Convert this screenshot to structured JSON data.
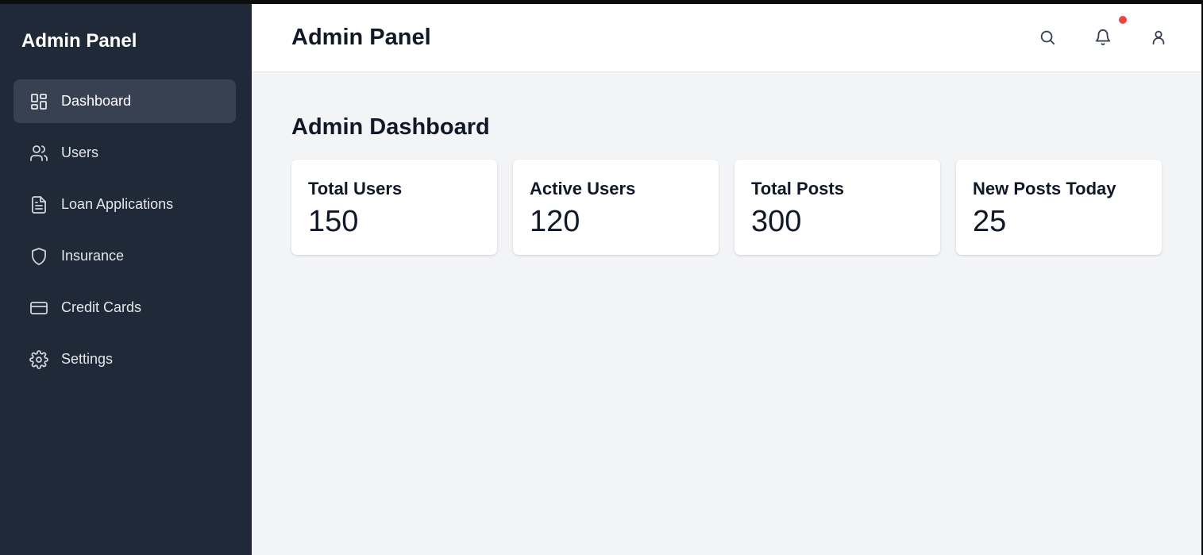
{
  "sidebar": {
    "brand": "Admin Panel",
    "items": [
      {
        "label": "Dashboard",
        "icon": "dashboard-icon",
        "active": true
      },
      {
        "label": "Users",
        "icon": "users-icon"
      },
      {
        "label": "Loan Applications",
        "icon": "document-icon"
      },
      {
        "label": "Insurance",
        "icon": "shield-icon"
      },
      {
        "label": "Credit Cards",
        "icon": "credit-card-icon"
      },
      {
        "label": "Settings",
        "icon": "gear-icon"
      }
    ]
  },
  "header": {
    "title": "Admin Panel",
    "icons": [
      "search-icon",
      "bell-icon",
      "user-icon"
    ],
    "has_notification": true
  },
  "main": {
    "title": "Admin Dashboard",
    "stats": [
      {
        "label": "Total Users",
        "value": "150"
      },
      {
        "label": "Active Users",
        "value": "120"
      },
      {
        "label": "Total Posts",
        "value": "300"
      },
      {
        "label": "New Posts Today",
        "value": "25"
      }
    ]
  },
  "colors": {
    "sidebar_bg": "#1f2937",
    "active_item_bg": "#374151",
    "main_bg": "#f3f4f6",
    "notification_dot": "#ef4444"
  }
}
